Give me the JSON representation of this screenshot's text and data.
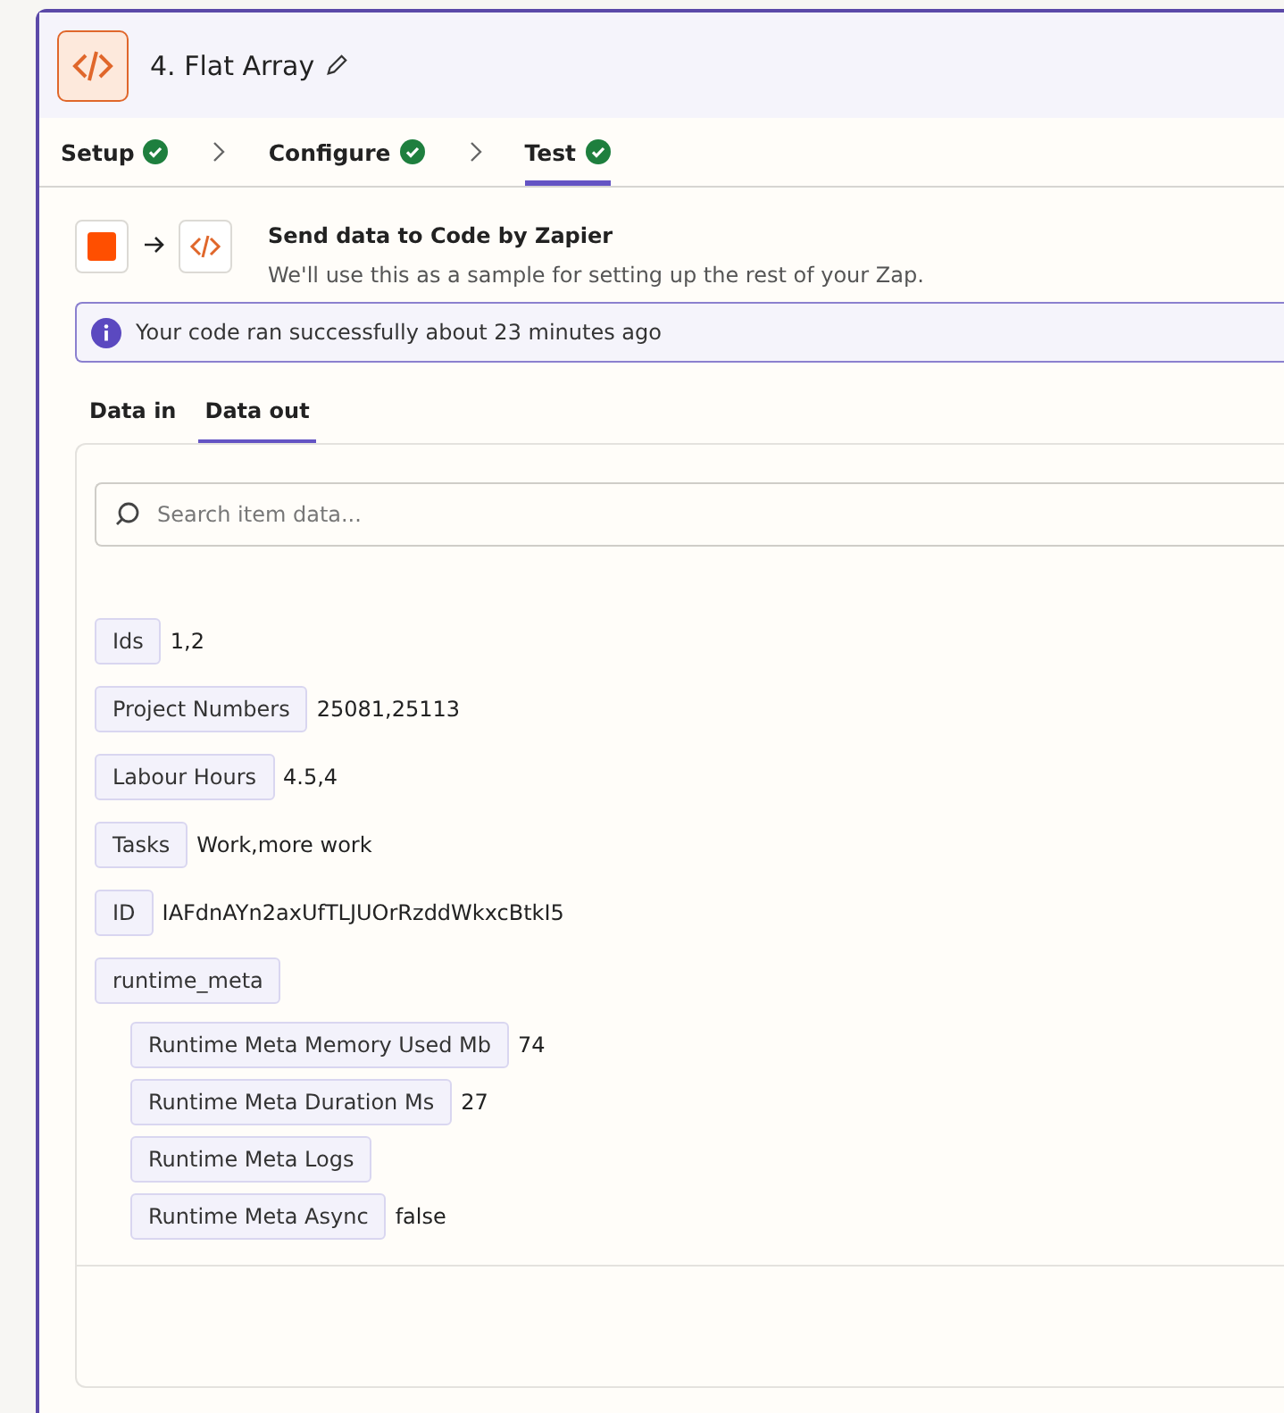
{
  "step": {
    "title": "4. Flat Array"
  },
  "steps": [
    {
      "label": "Setup",
      "done": true,
      "selected": false
    },
    {
      "label": "Configure",
      "done": true,
      "selected": false
    },
    {
      "label": "Test",
      "done": true,
      "selected": true
    }
  ],
  "source": {
    "title": "Send data to Code by Zapier",
    "subtitle": "We'll use this as a sample for setting up the rest of your Zap."
  },
  "notice": "Your code ran successfully about 23 minutes ago",
  "data_tabs": [
    {
      "label": "Data in",
      "selected": false
    },
    {
      "label": "Data out",
      "selected": true
    }
  ],
  "search": {
    "placeholder": "Search item data..."
  },
  "fields": [
    {
      "key": "Ids",
      "value": "1,2"
    },
    {
      "key": "Project Numbers",
      "value": "25081,25113"
    },
    {
      "key": "Labour Hours",
      "value": "4.5,4"
    },
    {
      "key": "Tasks",
      "value": "Work,more work"
    },
    {
      "key": "ID",
      "value": "IAFdnAYn2axUfTLJUOrRzddWkxcBtkI5"
    },
    {
      "key": "runtime_meta",
      "children": [
        {
          "key": "Runtime Meta Memory Used Mb",
          "value": "74"
        },
        {
          "key": "Runtime Meta Duration Ms",
          "value": "27"
        },
        {
          "key": "Runtime Meta Logs"
        },
        {
          "key": "Runtime Meta Async",
          "value": "false"
        }
      ]
    }
  ]
}
